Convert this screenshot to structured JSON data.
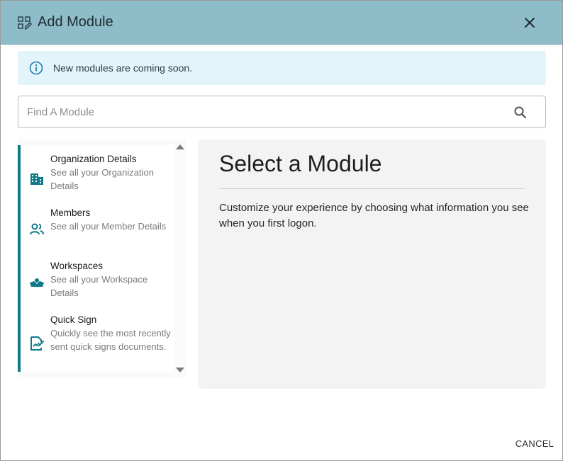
{
  "dialog": {
    "title": "Add Module",
    "close_icon": "close-icon",
    "header_icon": "add-module-icon"
  },
  "banner": {
    "icon": "info-icon",
    "text": "New modules are coming soon."
  },
  "search": {
    "placeholder": "Find A Module",
    "value": "",
    "icon": "search-icon"
  },
  "modules": [
    {
      "title": "Organization Details",
      "description": "See all your Organization Details",
      "icon": "building-icon"
    },
    {
      "title": "Members",
      "description": "See all your Member Details",
      "icon": "members-icon"
    },
    {
      "title": "Workspaces",
      "description": "See all your Workspace Details",
      "icon": "workspace-icon"
    },
    {
      "title": "Quick Sign",
      "description": "Quickly see the most recently sent quick signs documents.",
      "icon": "quick-sign-icon"
    }
  ],
  "detail": {
    "title": "Select a Module",
    "text": "Customize your experience by choosing what information you see when you first logon."
  },
  "footer": {
    "cancel_label": "CANCEL"
  },
  "colors": {
    "header_bg": "#8fbcc9",
    "banner_bg": "#e3f4fb",
    "accent": "#0f7a8a",
    "panel_bg": "#f3f3f3"
  }
}
